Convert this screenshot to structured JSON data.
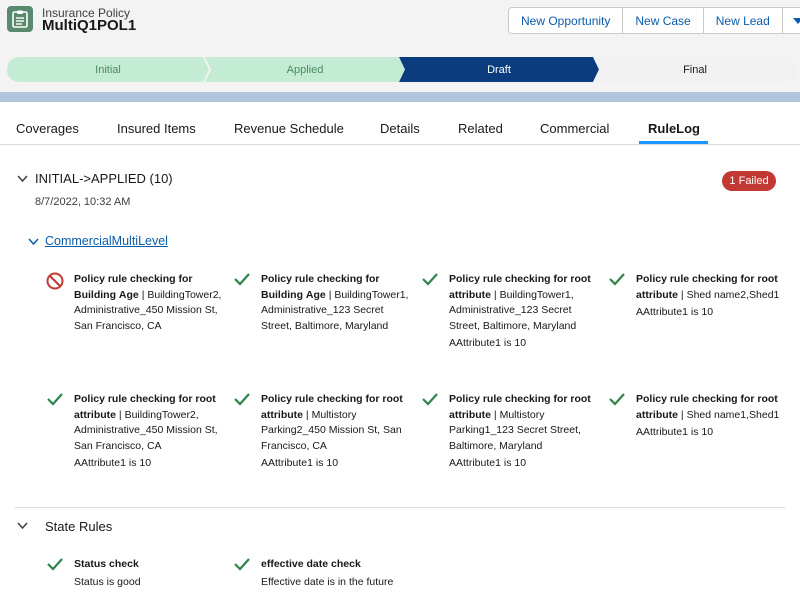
{
  "header": {
    "object_type": "Insurance Policy",
    "record_name": "MultiQ1POL1",
    "actions": [
      "New Opportunity",
      "New Case",
      "New Lead"
    ]
  },
  "path": {
    "stages": [
      {
        "label": "Initial",
        "status": "complete"
      },
      {
        "label": "Applied",
        "status": "complete"
      },
      {
        "label": "Draft",
        "status": "current"
      },
      {
        "label": "Final",
        "status": "incomplete"
      }
    ]
  },
  "tabs": [
    "Coverages",
    "Insured Items",
    "Revenue Schedule",
    "Details",
    "Related",
    "Commercial",
    "RuleLog"
  ],
  "active_tab": "RuleLog",
  "rulelog": {
    "transition": "INITIAL->APPLIED (10)",
    "timestamp": "8/7/2022, 10:32 AM",
    "badge": "1 Failed",
    "group": "CommercialMultiLevel",
    "rules": [
      {
        "status": "failed",
        "title": "Policy rule checking for Building",
        "title_tail": "Age",
        "detail": "| BuildingTower2, Administrative_450 Mission St, San Francisco, CA",
        "result": ""
      },
      {
        "status": "passed",
        "title": "Policy rule checking for Building",
        "title_tail": "Age",
        "detail": "| BuildingTower1, Administrative_123 Secret Street, Baltimore, Maryland",
        "result": ""
      },
      {
        "status": "passed",
        "title": "Policy rule checking for root attribute",
        "title_tail": "",
        "detail": "| BuildingTower1, Administrative_123 Secret Street, Baltimore, Maryland",
        "result": "AAttribute1 is 10"
      },
      {
        "status": "passed",
        "title": "Policy rule checking for root attribute",
        "title_tail": "",
        "detail": "| Shed name2,Shed1",
        "result": "AAttribute1 is 10"
      },
      {
        "status": "passed",
        "title": "Policy rule checking for root attribute",
        "title_tail": "",
        "detail": "| BuildingTower2, Administrative_450 Mission St, San Francisco, CA",
        "result": "AAttribute1 is 10"
      },
      {
        "status": "passed",
        "title": "Policy rule checking for root attribute",
        "title_tail": "",
        "detail": "| Multistory Parking2_450 Mission St, San Francisco, CA",
        "result": "AAttribute1 is 10"
      },
      {
        "status": "passed",
        "title": "Policy rule checking for root attribute",
        "title_tail": "",
        "detail": "| Multistory Parking1_123 Secret Street, Baltimore, Maryland",
        "result": "AAttribute1 is 10"
      },
      {
        "status": "passed",
        "title": "Policy rule checking for root attribute",
        "title_tail": "",
        "detail": "| Shed name1,Shed1",
        "result": "AAttribute1 is 10"
      }
    ]
  },
  "state_rules": {
    "title": "State Rules",
    "rules": [
      {
        "status": "passed",
        "title": "Status check",
        "result": "Status is good"
      },
      {
        "status": "passed",
        "title": "effective date check",
        "result": "Effective date is in the future"
      }
    ]
  },
  "colors": {
    "brand": "#0b3c7d",
    "link": "#0b5cab",
    "success": "#2e844a",
    "error": "#c23934",
    "complete_stage": "#c4ecd4"
  }
}
